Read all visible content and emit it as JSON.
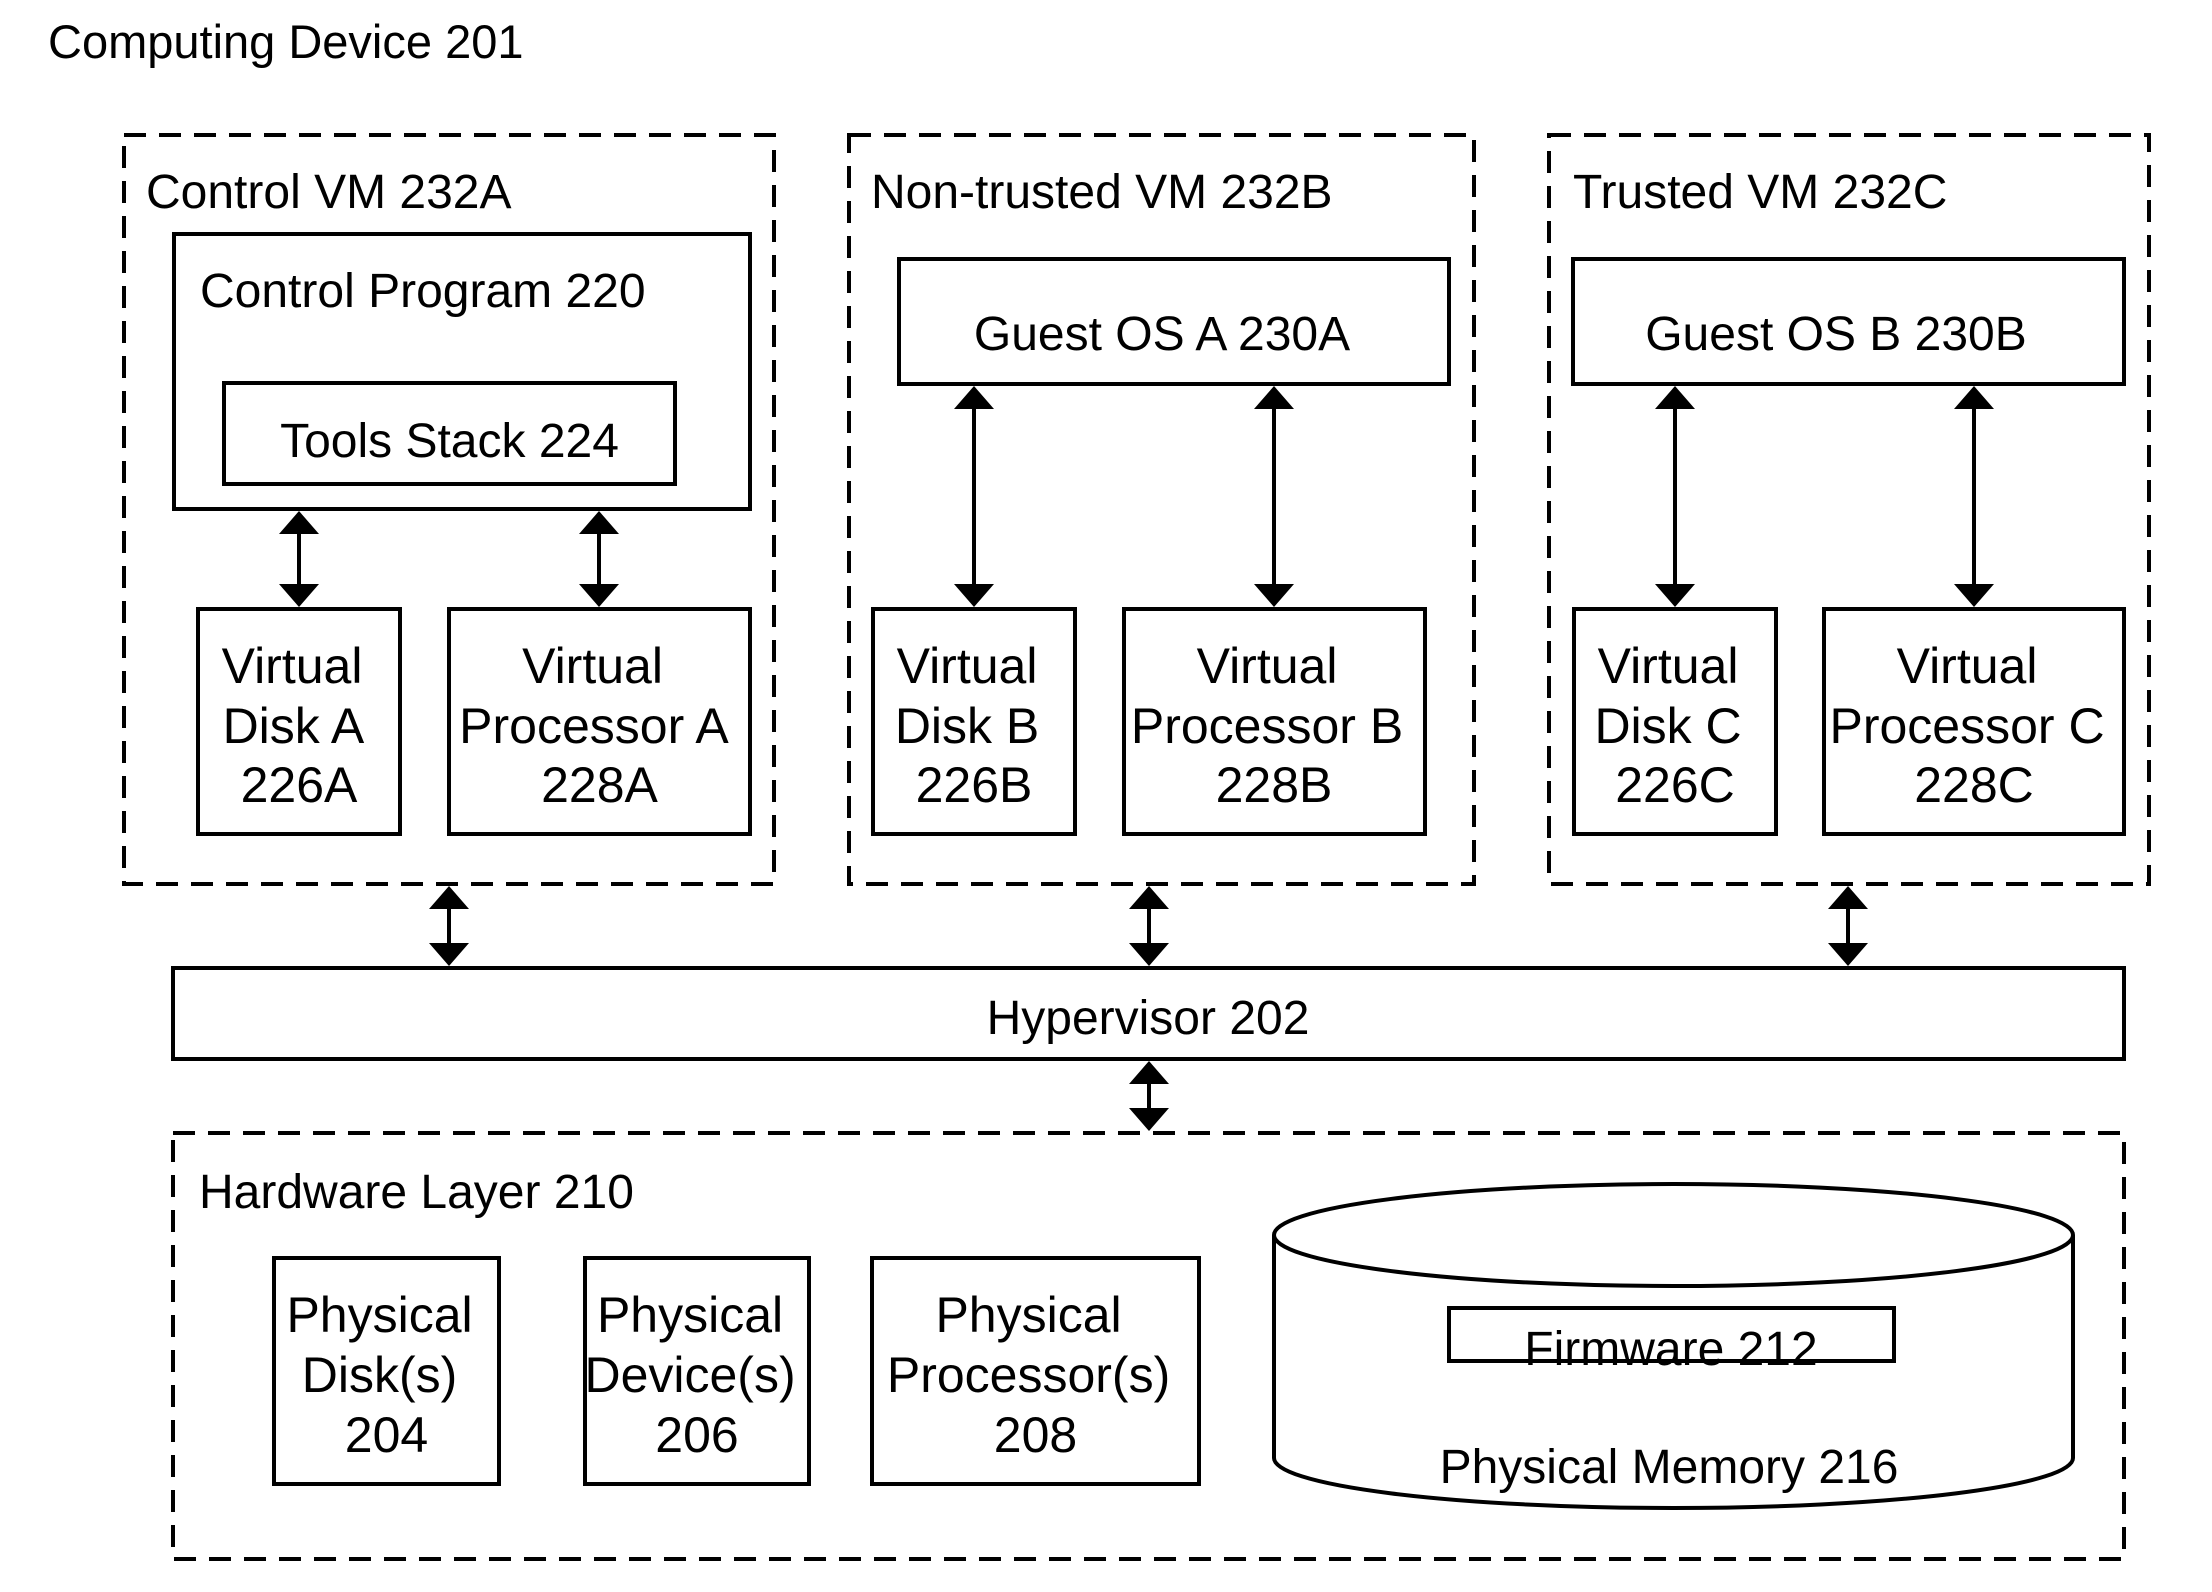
{
  "title": "Computing Device 201",
  "vms": [
    {
      "id": "control-vm",
      "label": "Control VM 232A",
      "top_box": {
        "label": "Control Program 220",
        "inner": {
          "label": "Tools Stack 224"
        }
      },
      "disk": {
        "lines": [
          "Virtual",
          "Disk A",
          "226A"
        ]
      },
      "processor": {
        "lines": [
          "Virtual",
          "Processor A",
          "228A"
        ]
      }
    },
    {
      "id": "non-trusted-vm",
      "label": "Non-trusted VM 232B",
      "top_box": {
        "label": "Guest OS A 230A"
      },
      "disk": {
        "lines": [
          "Virtual",
          "Disk B",
          "226B"
        ]
      },
      "processor": {
        "lines": [
          "Virtual",
          "Processor B",
          "228B"
        ]
      }
    },
    {
      "id": "trusted-vm",
      "label": "Trusted VM 232C",
      "top_box": {
        "label": "Guest OS B 230B"
      },
      "disk": {
        "lines": [
          "Virtual",
          "Disk C",
          "226C"
        ]
      },
      "processor": {
        "lines": [
          "Virtual",
          "Processor C",
          "228C"
        ]
      }
    }
  ],
  "hypervisor": {
    "label": "Hypervisor 202"
  },
  "hardware": {
    "label": "Hardware Layer 210",
    "components": [
      {
        "id": "physical-disks",
        "lines": [
          "Physical",
          "Disk(s)",
          "204"
        ]
      },
      {
        "id": "physical-devices",
        "lines": [
          "Physical",
          "Device(s)",
          "206"
        ]
      },
      {
        "id": "physical-processors",
        "lines": [
          "Physical",
          "Processor(s)",
          "208"
        ]
      }
    ],
    "memory": {
      "label": "Physical Memory 216",
      "firmware": {
        "label": "Firmware 212"
      }
    }
  },
  "connections": [
    {
      "from": "Control Program 220",
      "to": "Virtual Disk A 226A",
      "type": "bidirectional"
    },
    {
      "from": "Control Program 220",
      "to": "Virtual Processor A 228A",
      "type": "bidirectional"
    },
    {
      "from": "Guest OS A 230A",
      "to": "Virtual Disk B 226B",
      "type": "bidirectional"
    },
    {
      "from": "Guest OS A 230A",
      "to": "Virtual Processor B 228B",
      "type": "bidirectional"
    },
    {
      "from": "Guest OS B 230B",
      "to": "Virtual Disk C 226C",
      "type": "bidirectional"
    },
    {
      "from": "Guest OS B 230B",
      "to": "Virtual Processor C 228C",
      "type": "bidirectional"
    },
    {
      "from": "Control VM 232A",
      "to": "Hypervisor 202",
      "type": "bidirectional"
    },
    {
      "from": "Non-trusted VM 232B",
      "to": "Hypervisor 202",
      "type": "bidirectional"
    },
    {
      "from": "Trusted VM 232C",
      "to": "Hypervisor 202",
      "type": "bidirectional"
    },
    {
      "from": "Hypervisor 202",
      "to": "Hardware Layer 210",
      "type": "bidirectional"
    }
  ]
}
